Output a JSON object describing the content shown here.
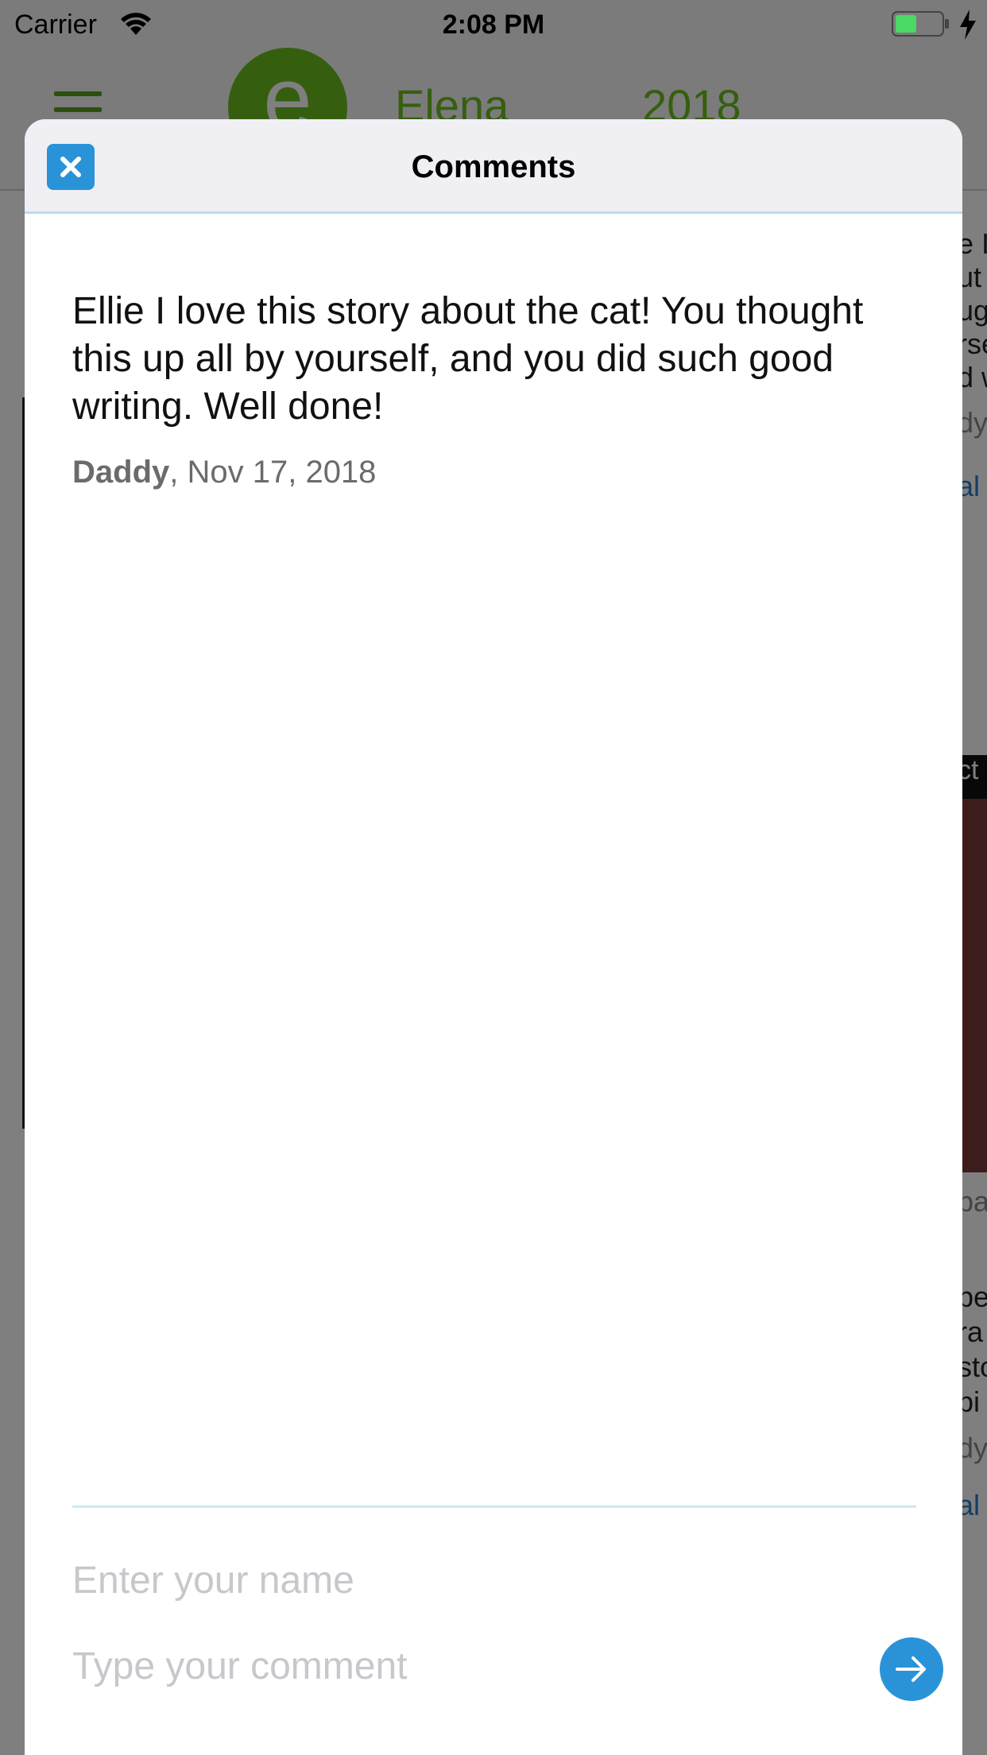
{
  "status_bar": {
    "carrier": "Carrier",
    "time": "2:08 PM",
    "battery_color": "#4cd964"
  },
  "background_app": {
    "logo_letter": "e",
    "child_name": "Elena",
    "year": "2018",
    "accent_color": "#6bbf1f",
    "right_fragments": [
      "e I",
      "ut",
      "ug",
      "rse",
      "d w",
      "dy",
      "al",
      "ct",
      "pa",
      "pe",
      "ra",
      "sto",
      "pi",
      "dy",
      "al"
    ]
  },
  "modal": {
    "title": "Comments",
    "close_icon": "close-icon",
    "accent_color": "#2a93d8",
    "comments": [
      {
        "text": "Ellie I love this story about the cat! You thought this up all by yourself, and you did such good writing. Well done!",
        "author": "Daddy",
        "date": ", Nov 17, 2018"
      }
    ],
    "form": {
      "name_placeholder": "Enter your name",
      "comment_placeholder": "Type your comment",
      "send_icon": "arrow-right-icon"
    }
  }
}
